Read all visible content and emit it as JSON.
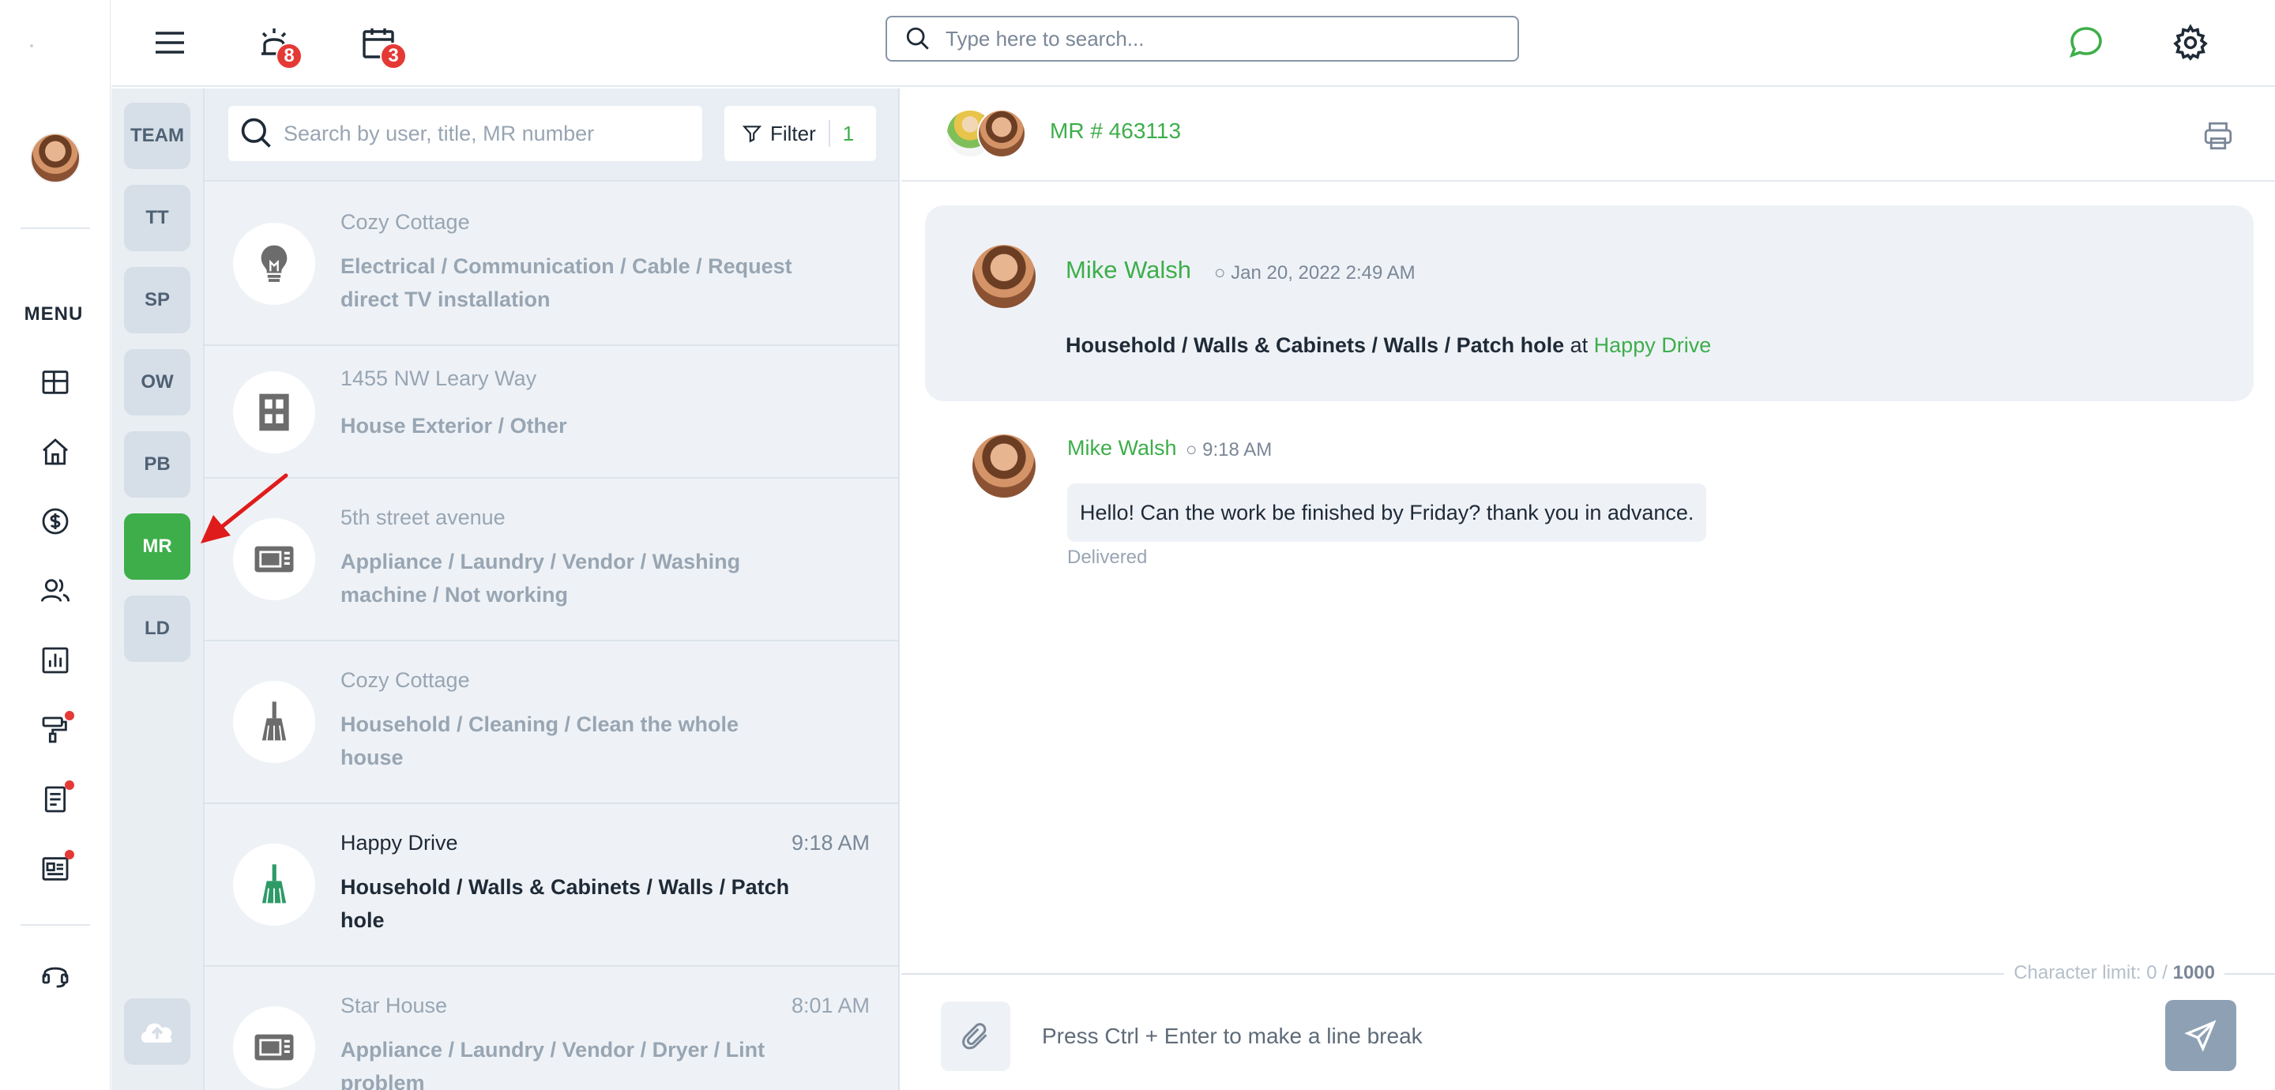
{
  "rail": {
    "menu_label": "MENU"
  },
  "topbar": {
    "alarm_count": "8",
    "calendar_count": "3",
    "search_placeholder": "Type here to search..."
  },
  "categories": [
    {
      "label": "TEAM",
      "active": false
    },
    {
      "label": "TT",
      "active": false
    },
    {
      "label": "SP",
      "active": false
    },
    {
      "label": "OW",
      "active": false
    },
    {
      "label": "PB",
      "active": false
    },
    {
      "label": "MR",
      "active": true
    },
    {
      "label": "LD",
      "active": false
    }
  ],
  "list": {
    "search_placeholder": "Search by user, title, MR number",
    "filter_label": "Filter",
    "filter_count": "1",
    "rows": [
      {
        "icon": "lightbulb-icon",
        "location": "Cozy Cottage",
        "time": "",
        "title": "Electrical / Communication / Cable / Request direct TV installation"
      },
      {
        "icon": "building-icon",
        "location": "1455 NW Leary Way",
        "time": "",
        "title": "House Exterior / Other"
      },
      {
        "icon": "appliance-icon",
        "location": "5th street avenue",
        "time": "",
        "title": "Appliance / Laundry / Vendor / Washing machine / Not working"
      },
      {
        "icon": "broom-icon",
        "location": "Cozy Cottage",
        "time": "",
        "title": "Household / Cleaning / Clean the whole house"
      },
      {
        "icon": "broom-icon",
        "location": "Happy Drive",
        "time": "9:18 AM",
        "title": "Household / Walls & Cabinets / Walls / Patch hole"
      },
      {
        "icon": "appliance-icon",
        "location": "Star House",
        "time": "8:01 AM",
        "title": "Appliance / Laundry / Vendor / Dryer / Lint problem"
      }
    ]
  },
  "conversation": {
    "mr_label": "MR # 463113",
    "request": {
      "author": "Mike Walsh",
      "timestamp": "○ Jan 20, 2022 2:49 AM",
      "category": "Household / Walls & Cabinets / Walls / Patch hole",
      "at_word": "at",
      "location": "Happy Drive"
    },
    "message": {
      "author": "Mike Walsh",
      "timestamp": "○ 9:18 AM",
      "text": "Hello! Can the work be finished by Friday? thank you in advance.",
      "status": "Delivered"
    },
    "composer": {
      "char_limit_label": "Character limit: 0 /",
      "char_limit_max": "1000",
      "placeholder": "Press Ctrl + Enter to make a line break"
    }
  },
  "colors": {
    "accent_green": "#3dae4a",
    "badge_red": "#e53935",
    "send_button": "#8ea1b4"
  }
}
